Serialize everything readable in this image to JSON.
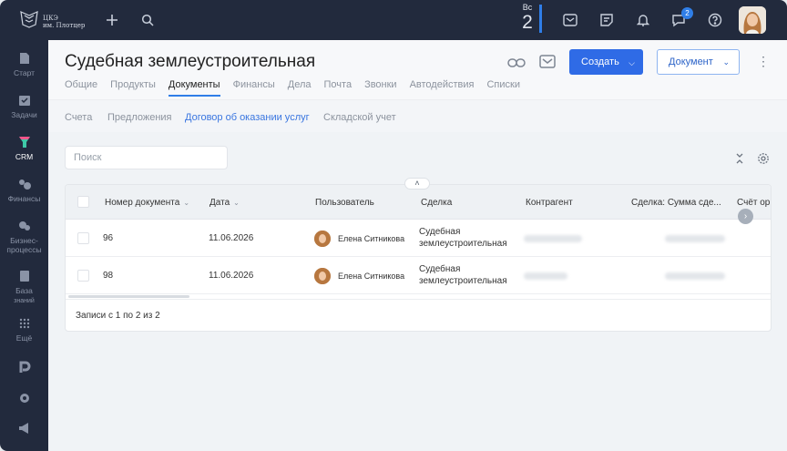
{
  "topbar": {
    "logo_line1": "ЦКЭ",
    "logo_line2": "им. Плотцер",
    "day_name": "Вс",
    "day_number": "2",
    "chat_badge": "2",
    "accent": "#2f7ee8"
  },
  "sidebar": {
    "items": [
      {
        "label": "Старт",
        "icon": "start-icon"
      },
      {
        "label": "Задачи",
        "icon": "tasks-icon"
      },
      {
        "label": "CRM",
        "icon": "crm-icon"
      },
      {
        "label": "Финансы",
        "icon": "finance-icon"
      },
      {
        "label": "Бизнес-",
        "label2": "процессы",
        "icon": "business-process-icon"
      },
      {
        "label": "База",
        "label2": "знаний",
        "icon": "knowledge-base-icon"
      },
      {
        "label": "Ещё",
        "icon": "more-grid-icon"
      }
    ]
  },
  "header": {
    "title": "Судебная землеустроительная",
    "tabs": [
      "Общие",
      "Продукты",
      "Документы",
      "Финансы",
      "Дела",
      "Почта",
      "Звонки",
      "Автодействия",
      "Списки"
    ],
    "active_tab": "Документы",
    "create_label": "Создать",
    "document_label": "Документ"
  },
  "subtabs": [
    "Счета",
    "Предложения",
    "Договор об оказании услуг",
    "Складской учет"
  ],
  "search": {
    "placeholder": "Поиск"
  },
  "table": {
    "columns": [
      "Номер документа",
      "Дата",
      "Пользователь",
      "Сделка",
      "Контрагент",
      "Сделка: Сумма сде...",
      "Счёт орг"
    ],
    "rows": [
      {
        "number": "96",
        "date": "11.06.2026",
        "user": "Елена Ситникова",
        "deal_line1": "Судебная",
        "deal_line2": "землеустроительная"
      },
      {
        "number": "98",
        "date": "11.06.2026",
        "user": "Елена Ситникова",
        "deal_line1": "Судебная",
        "deal_line2": "землеустроительная"
      }
    ],
    "footer": "Записи с 1 по 2 из 2"
  }
}
